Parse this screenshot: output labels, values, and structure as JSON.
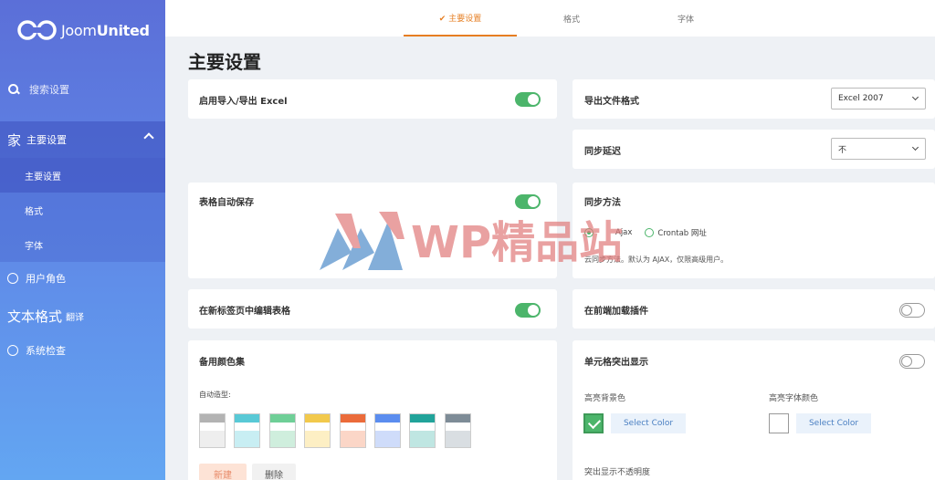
{
  "brand": {
    "logo_text_light": "Joom",
    "logo_text_bold": "United"
  },
  "sidebar": {
    "search_placeholder": "搜索设置",
    "group": {
      "icon": "家",
      "label": "主要设置"
    },
    "sub_items": [
      "主要设置",
      "格式",
      "字体"
    ],
    "items": [
      {
        "label": "用户角色",
        "icon": "user-circle-icon"
      },
      {
        "big": "文本格式",
        "small": "翻译"
      },
      {
        "label": "系统检查",
        "icon": "check-circle-icon"
      }
    ]
  },
  "tabs": [
    {
      "label": "✔ 主要设置",
      "active": true
    },
    {
      "label": "格式",
      "active": false
    },
    {
      "label": "字体",
      "active": false
    }
  ],
  "page_title": "主要设置",
  "settings": {
    "import_export": {
      "label": "启用导入/导出 Excel",
      "on": true
    },
    "export_format": {
      "label": "导出文件格式",
      "value": "Excel 2007"
    },
    "sync_delay": {
      "label": "同步延迟",
      "value": "不"
    },
    "autosave": {
      "label": "表格自动保存",
      "on": true
    },
    "sync_method": {
      "label": "同步方法",
      "options": [
        "Ajax",
        "Crontab 网址"
      ],
      "selected": 0,
      "note": "云同步方法。默认为 AJAX，仅限高级用户。"
    },
    "edit_new_tab": {
      "label": "在新标签页中编辑表格",
      "on": true
    },
    "frontend_plugins": {
      "label": "在前端加载插件",
      "on": false
    },
    "alt_colors": {
      "label": "备用颜色集",
      "sublabel": "自动造型:",
      "swatches": [
        [
          "#b3b3b3",
          "#ffffff",
          "#eeeeee"
        ],
        [
          "#59c9d6",
          "#ffffff",
          "#c8eef3"
        ],
        [
          "#6fcf97",
          "#ffffff",
          "#cfeedd"
        ],
        [
          "#f2c94c",
          "#ffffff",
          "#fdefc4"
        ],
        [
          "#eb6b3a",
          "#ffffff",
          "#fbd6c7"
        ],
        [
          "#5b8def",
          "#ffffff",
          "#cfdcfa"
        ],
        [
          "#21a39a",
          "#ffffff",
          "#bfe6e2"
        ],
        [
          "#7e8c97",
          "#ffffff",
          "#d9dee2"
        ]
      ],
      "new_label": "新建",
      "delete_label": "删除"
    },
    "highlight": {
      "label": "单元格突出显示",
      "on": false,
      "bg_label": "高亮背景色",
      "font_label": "高亮字体颜色",
      "select_color": "Select Color",
      "opacity_label": "突出显示不透明度"
    }
  },
  "watermark": "WP精品站",
  "colors": {
    "accent": "#e67e22",
    "toggle_on": "#4cb56b",
    "sidebar_top": "#5b6fd8",
    "sidebar_bottom": "#63a6f2"
  }
}
